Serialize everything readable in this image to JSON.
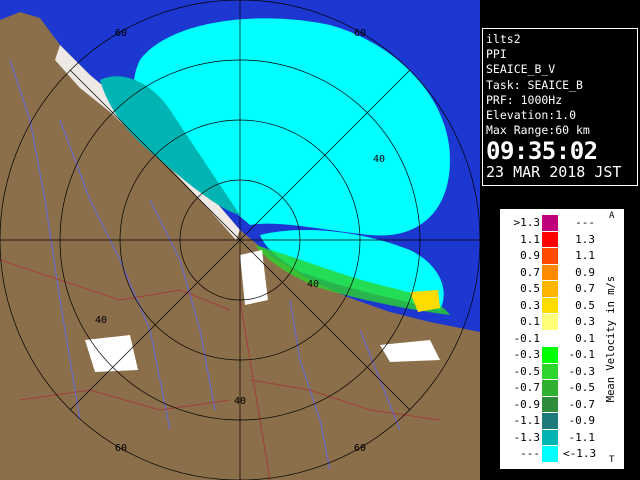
{
  "info": {
    "site": "ilts2",
    "mode": "PPI",
    "product": "SEAICE_B_V",
    "task": "Task: SEAICE_B",
    "prf": "PRF: 1000Hz",
    "elevation": "Elevation:1.0",
    "range": "Max Range:60 km",
    "time": "09:35:02",
    "date": "23 MAR 2018 JST"
  },
  "legend": {
    "unit_label": "Mean Velocity in m/s",
    "top_mark": "A",
    "bottom_mark": "T",
    "rows": [
      {
        "lo": ">1.3",
        "hi": "---",
        "color": "#c0007a"
      },
      {
        "lo": "1.1",
        "hi": "1.3",
        "color": "#ff0000"
      },
      {
        "lo": "0.9",
        "hi": "1.1",
        "color": "#ff4a00"
      },
      {
        "lo": "0.7",
        "hi": "0.9",
        "color": "#ff8a00"
      },
      {
        "lo": "0.5",
        "hi": "0.7",
        "color": "#ffb400"
      },
      {
        "lo": "0.3",
        "hi": "0.5",
        "color": "#ffdc00"
      },
      {
        "lo": "0.1",
        "hi": "0.3",
        "color": "#ffff7a"
      },
      {
        "lo": "-0.1",
        "hi": "0.1",
        "color": "#ffffff"
      },
      {
        "lo": "-0.3",
        "hi": "-0.1",
        "color": "#00ff00"
      },
      {
        "lo": "-0.5",
        "hi": "-0.3",
        "color": "#2cd42c"
      },
      {
        "lo": "-0.7",
        "hi": "-0.5",
        "color": "#30b030"
      },
      {
        "lo": "-0.9",
        "hi": "-0.7",
        "color": "#2e8c3a"
      },
      {
        "lo": "-1.1",
        "hi": "-0.9",
        "color": "#1e7a7a"
      },
      {
        "lo": "-1.3",
        "hi": "-1.1",
        "color": "#00b4b4"
      },
      {
        "lo": "---",
        "hi": "<-1.3",
        "color": "#00ffff"
      }
    ]
  },
  "map": {
    "range_labels": [
      "60",
      "40",
      "40",
      "60",
      "60",
      "40",
      "40",
      "60"
    ],
    "colors": {
      "sea": "#1c38d0",
      "land": "#8b6e4a",
      "echo_strong": "#00ffff",
      "echo_mid": "#00b4b4",
      "echo_green": "#2cd42c",
      "snow": "#ffffff",
      "rings": "#000000",
      "rivers": "#6a6acc",
      "boundaries": "#a04040"
    }
  }
}
